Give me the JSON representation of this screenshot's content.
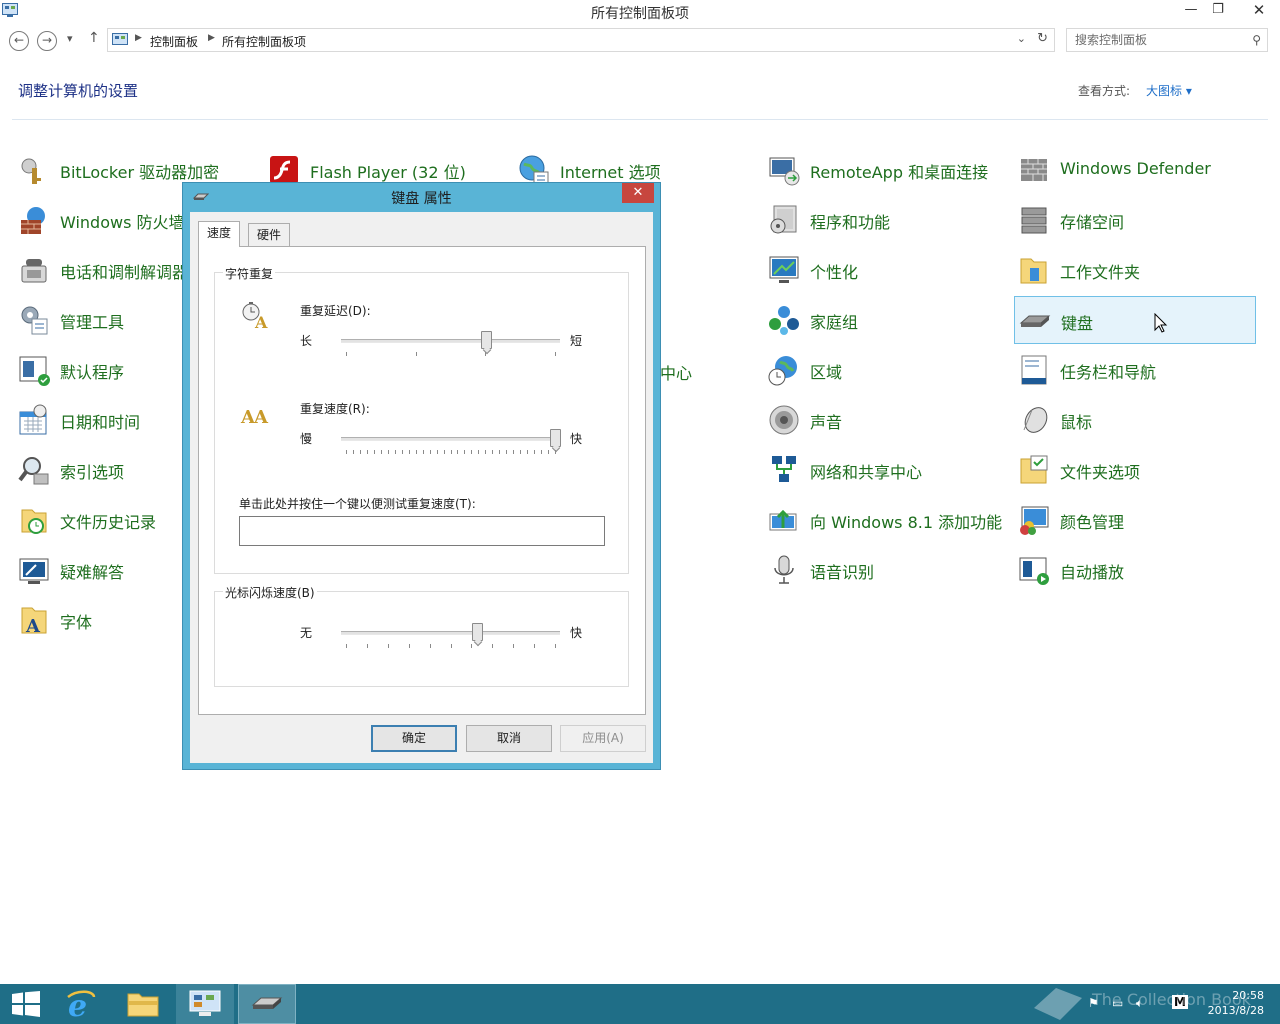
{
  "window": {
    "title": "所有控制面板项",
    "minimize": "—",
    "restore": "❐",
    "close": "✕"
  },
  "nav": {
    "back": "←",
    "forward": "→",
    "recent": "▾",
    "up": "↑",
    "breadcrumb": [
      "控制面板",
      "所有控制面板项"
    ],
    "dropdown": "⌄",
    "refresh": "↻",
    "search_placeholder": "搜索控制面板"
  },
  "header": {
    "title": "调整计算机的设置",
    "view_by_label": "查看方式:",
    "view_by_value": "大图标 ▾"
  },
  "items": {
    "col1": [
      "BitLocker 驱动器加密",
      "Windows 防火墙",
      "电话和调制解调器",
      "管理工具",
      "默认程序",
      "日期和时间",
      "索引选项",
      "文件历史记录",
      "疑难解答",
      "字体"
    ],
    "col2": [
      "Flash Player (32 位)"
    ],
    "col3": [
      "Internet 选项"
    ],
    "partial": "中心",
    "col4": [
      "RemoteApp 和桌面连接",
      "程序和功能",
      "个性化",
      "家庭组",
      "区域",
      "声音",
      "网络和共享中心",
      "向 Windows 8.1 添加功能",
      "语音识别"
    ],
    "col5": [
      "Windows Defender",
      "存储空间",
      "工作文件夹",
      "键盘",
      "任务栏和导航",
      "鼠标",
      "文件夹选项",
      "颜色管理",
      "自动播放"
    ]
  },
  "dialog": {
    "title": "键盘 属性",
    "close": "✕",
    "tabs": [
      "速度",
      "硬件"
    ],
    "repeat_group": "字符重复",
    "repeat_delay_label": "重复延迟(D):",
    "repeat_delay_min": "长",
    "repeat_delay_max": "短",
    "repeat_delay_value": 0.67,
    "repeat_rate_label": "重复速度(R):",
    "repeat_rate_min": "慢",
    "repeat_rate_max": "快",
    "repeat_rate_value": 1.0,
    "test_label": "单击此处并按住一个键以便测试重复速度(T):",
    "test_value": "",
    "blink_group": "光标闪烁速度(B)",
    "blink_min": "无",
    "blink_max": "快",
    "blink_value": 0.63,
    "ok": "确定",
    "cancel": "取消",
    "apply": "应用(A)"
  },
  "taskbar": {
    "time": "20:58",
    "date": "2013/8/28",
    "ime": "M",
    "watermark": "The Collection Book"
  },
  "colors": {
    "accent": "#59b4d6",
    "taskbar": "#1f6e87",
    "link_green": "#1e6e1e",
    "selection": "#e5f3fb"
  }
}
